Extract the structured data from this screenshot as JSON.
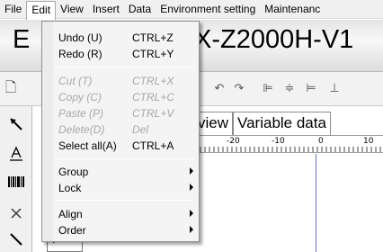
{
  "menubar": {
    "items": [
      "File",
      "Edit",
      "View",
      "Insert",
      "Data",
      "Environment setting",
      "Maintenanc"
    ]
  },
  "title": {
    "left": "E",
    "right": "X-Z2000H-V1"
  },
  "tabs": [
    "view",
    "Variable data"
  ],
  "ruler": [
    "-20",
    "-10",
    "0",
    "10"
  ],
  "canvas_box": "I",
  "edit_menu": {
    "undo": {
      "label": "Undo (U)",
      "shortcut": "CTRL+Z"
    },
    "redo": {
      "label": "Redo (R)",
      "shortcut": "CTRL+Y"
    },
    "cut": {
      "label": "Cut (T)",
      "shortcut": "CTRL+X"
    },
    "copy": {
      "label": "Copy (C)",
      "shortcut": "CTRL+C"
    },
    "paste": {
      "label": "Paste (P)",
      "shortcut": "CTRL+V"
    },
    "delete": {
      "label": "Delete(D)",
      "shortcut": "Del"
    },
    "select_all": {
      "label": "Select all(A)",
      "shortcut": "CTRL+A"
    },
    "group": {
      "label": "Group"
    },
    "lock": {
      "label": "Lock"
    },
    "align": {
      "label": "Align"
    },
    "order": {
      "label": "Order"
    }
  },
  "icons": {
    "toolbar": [
      "new-document-icon",
      "undo-icon",
      "redo-icon",
      "align-left-icon",
      "align-center-icon",
      "align-right-icon",
      "align-bottom-icon"
    ],
    "palette": [
      "pointer-icon",
      "text-icon",
      "barcode-icon",
      "cross-icon",
      "line-icon"
    ]
  }
}
